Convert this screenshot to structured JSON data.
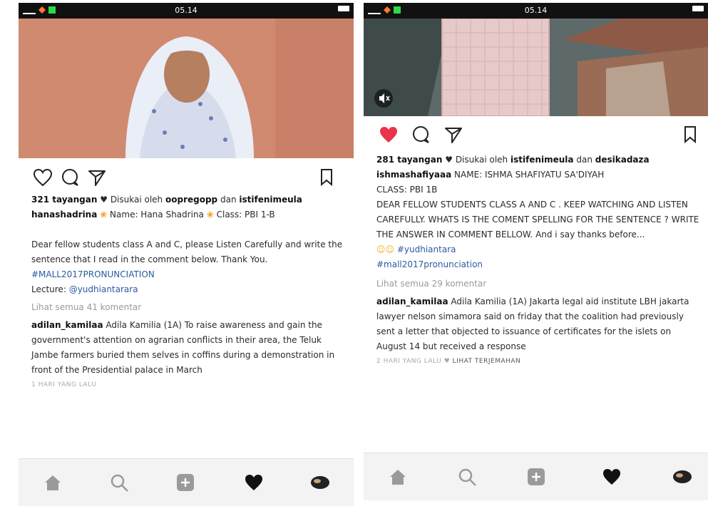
{
  "left": {
    "status": {
      "time": "05.14"
    },
    "likes_text": "321 tayangan",
    "liked_by": "Disukai oleh",
    "user_a": "oopregopp",
    "and": "dan",
    "user_b": "istifenimeula",
    "author": "hanashadrina",
    "name_line": "Name: Hana Shadrina",
    "class_line": "Class: PBI 1-B",
    "body_1": "Dear fellow students class A and C, please Listen Carefully and write the sentence that I read in the comment below. Thank You.",
    "hashtag": "#MALL2017PRONUNCIATION",
    "lecture_label": "Lecture:",
    "lecture_handle": "@yudhiantarara",
    "view_comments": "Lihat semua 41 komentar",
    "commenter": "adilan_kamilaa",
    "comment_text": "Adila Kamilia (1A) To raise awareness and gain the government's attention on agrarian conflicts in their area, the Teluk Jambe farmers buried them selves in coffins during a demonstration in front of the Presidential palace in March",
    "time_ago": "1 HARI YANG LALU"
  },
  "right": {
    "status": {
      "time": "05.14"
    },
    "likes_text": "281 tayangan",
    "liked_by": "Disukai oleh",
    "user_a": "istifenimeula",
    "and": "dan",
    "user_b": "desikadaza",
    "author": "ishmashafiyaaa",
    "name_line": "NAME: ISHMA SHAFIYATU SA'DIYAH",
    "class_line": "CLASS: PBI 1B",
    "body_1": "DEAR FELLOW STUDENTS CLASS A AND C . KEEP WATCHING AND LISTEN CAREFULLY. WHATS IS THE COMENT SPELLING FOR THE SENTENCE ? WRITE THE ANSWER IN COMMENT BELLOW.",
    "body_2": "And i say thanks before...",
    "hashtag_1": "#yudhiantara",
    "hashtag_2": "#mall2017pronunciation",
    "view_comments": "Lihat semua 29 komentar",
    "commenter": "adilan_kamilaa",
    "comment_text": "Adila Kamilia (1A) Jakarta legal aid institute LBH jakarta lawyer nelson simamora said on friday that the coalition had previously sent a letter that objected to issuance of certificates for the islets on August 14 but received a response",
    "time_ago": "2 HARI YANG LALU",
    "see_translation": "LIHAT TERJEMAHAN"
  },
  "colors": {
    "heart_liked": "#e8334a",
    "link_blue": "#2c5aa0"
  }
}
